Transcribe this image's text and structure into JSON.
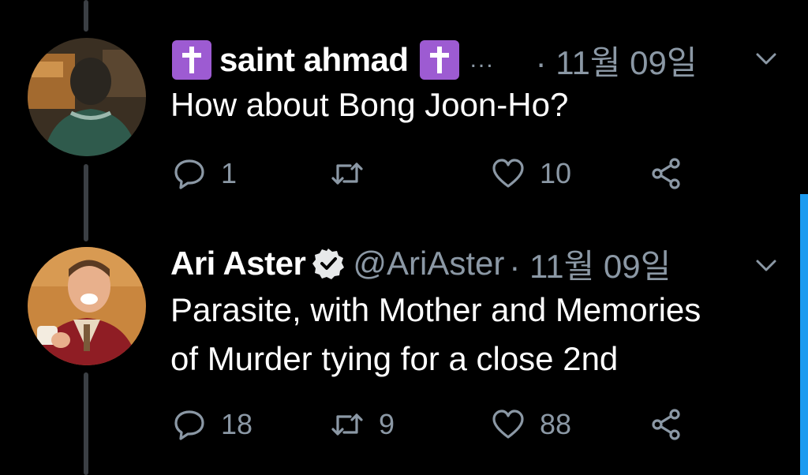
{
  "tweets": [
    {
      "name": "saint ahmad",
      "name_badge_icon": "latin-cross-icon",
      "truncated_handle": "...",
      "date": "· 11월 09일",
      "text": "How about Bong Joon-Ho?",
      "replies": "1",
      "retweets": "",
      "likes": "10"
    },
    {
      "name": "Ari Aster",
      "verified_icon": "verified-badge-icon",
      "handle": "@AriAster",
      "date": "· 11월 09일",
      "text_line1": "Parasite, with Mother and Memories",
      "text_line2": "of Murder tying for a close 2nd",
      "replies": "18",
      "retweets": "9",
      "likes": "88"
    }
  ],
  "colors": {
    "background": "#000000",
    "secondary_text": "#8b98a5",
    "thread_line": "#3b3f44",
    "badge_purple": "#9d5bd2",
    "accent": "#1d9bf0"
  }
}
